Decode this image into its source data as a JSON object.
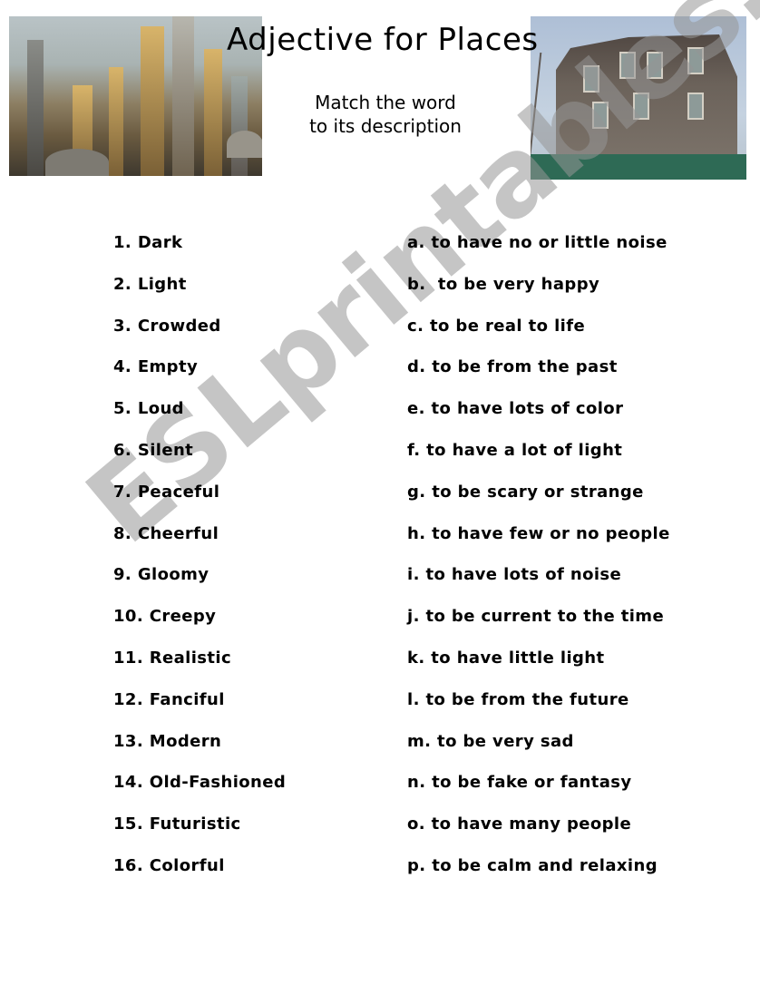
{
  "header": {
    "title": "Adjective for Places",
    "subtitle_line1": "Match the word",
    "subtitle_line2": "to its description",
    "left_image": "futuristic-city-illustration",
    "right_image": "old-abandoned-house-photo"
  },
  "words": [
    "1. Dark",
    "2. Light",
    "3. Crowded",
    "4. Empty",
    "5. Loud",
    "6. Silent",
    "7. Peaceful",
    "8. Cheerful",
    "9. Gloomy",
    "10. Creepy",
    "11. Realistic",
    "12. Fanciful",
    "13. Modern",
    "14. Old-Fashioned",
    "15. Futuristic",
    "16. Colorful"
  ],
  "descriptions": [
    "a. to have no or little noise",
    "b.  to be very happy",
    "c. to be real to life",
    "d. to be from the past",
    "e. to have lots of color",
    "f. to have a lot of light",
    "g. to be scary or strange",
    "h. to have few or no people",
    "i. to have lots of noise",
    "j. to be current to the time",
    "k. to have little light",
    "l. to be from the future",
    "m. to be very sad",
    "n. to be fake or fantasy",
    "o. to have many people",
    "p. to be calm and relaxing"
  ],
  "watermark": "ESLprintables.com"
}
